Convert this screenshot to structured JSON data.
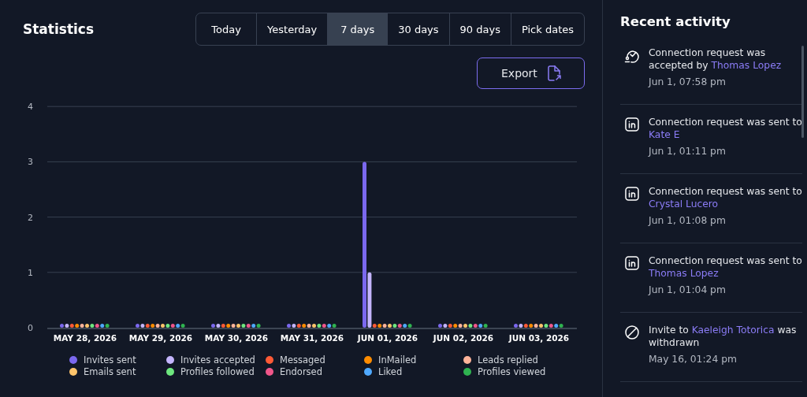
{
  "statistics": {
    "title": "Statistics",
    "ranges": [
      {
        "label": "Today",
        "selected": false
      },
      {
        "label": "Yesterday",
        "selected": false
      },
      {
        "label": "7 days",
        "selected": true
      },
      {
        "label": "30 days",
        "selected": false
      },
      {
        "label": "90 days",
        "selected": false
      },
      {
        "label": "Pick dates",
        "selected": false
      }
    ],
    "export_button": "Export",
    "chart_data": {
      "type": "bar",
      "categories": [
        "MAY 28, 2026",
        "MAY 29, 2026",
        "MAY 30, 2026",
        "MAY 31, 2026",
        "JUN 01, 2026",
        "JUN 02, 2026",
        "JUN 03, 2026"
      ],
      "ylim": [
        0,
        4
      ],
      "grid": true,
      "yticks": [
        0,
        1,
        2,
        3,
        4
      ],
      "series": [
        {
          "name": "Invites sent",
          "color": "#7b68ee",
          "values": [
            0,
            0,
            0,
            0,
            3,
            0,
            0
          ]
        },
        {
          "name": "Invites accepted",
          "color": "#c4b5fd",
          "values": [
            0,
            0,
            0,
            0,
            1,
            0,
            0
          ]
        },
        {
          "name": "Messaged",
          "color": "#ff5a36",
          "values": [
            0,
            0,
            0,
            0,
            0,
            0,
            0
          ]
        },
        {
          "name": "InMailed",
          "color": "#ff8c00",
          "values": [
            0,
            0,
            0,
            0,
            0,
            0,
            0
          ]
        },
        {
          "name": "Leads replied",
          "color": "#ffb49a",
          "values": [
            0,
            0,
            0,
            0,
            0,
            0,
            0
          ]
        },
        {
          "name": "Emails sent",
          "color": "#ffc46b",
          "values": [
            0,
            0,
            0,
            0,
            0,
            0,
            0
          ]
        },
        {
          "name": "Profiles followed",
          "color": "#6ee77f",
          "values": [
            0,
            0,
            0,
            0,
            0,
            0,
            0
          ]
        },
        {
          "name": "Endorsed",
          "color": "#f0568a",
          "values": [
            0,
            0,
            0,
            0,
            0,
            0,
            0
          ]
        },
        {
          "name": "Liked",
          "color": "#4fa9ff",
          "values": [
            0,
            0,
            0,
            0,
            0,
            0,
            0
          ]
        },
        {
          "name": "Profiles viewed",
          "color": "#2fb350",
          "values": [
            0,
            0,
            0,
            0,
            0,
            0,
            0
          ]
        }
      ]
    }
  },
  "recent_activity": {
    "title": "Recent activity",
    "items": [
      {
        "kind": "accepted",
        "before": "Connection request was accepted by ",
        "name": "Thomas Lopez",
        "time": "Jun 1, 07:58 pm"
      },
      {
        "kind": "linkedin",
        "before": "Connection request was sent to ",
        "name": "Kate E",
        "time": "Jun 1, 01:11 pm"
      },
      {
        "kind": "linkedin",
        "before": "Connection request was sent to ",
        "name": "Crystal Lucero",
        "time": "Jun 1, 01:08 pm"
      },
      {
        "kind": "linkedin",
        "before": "Connection request was sent to ",
        "name": "Thomas Lopez",
        "time": "Jun 1, 01:04 pm"
      },
      {
        "kind": "withdrawn",
        "before": "Invite to ",
        "name": "Kaeleigh Totorica",
        "after": " was withdrawn",
        "time": "May 16, 01:24 pm"
      }
    ]
  }
}
